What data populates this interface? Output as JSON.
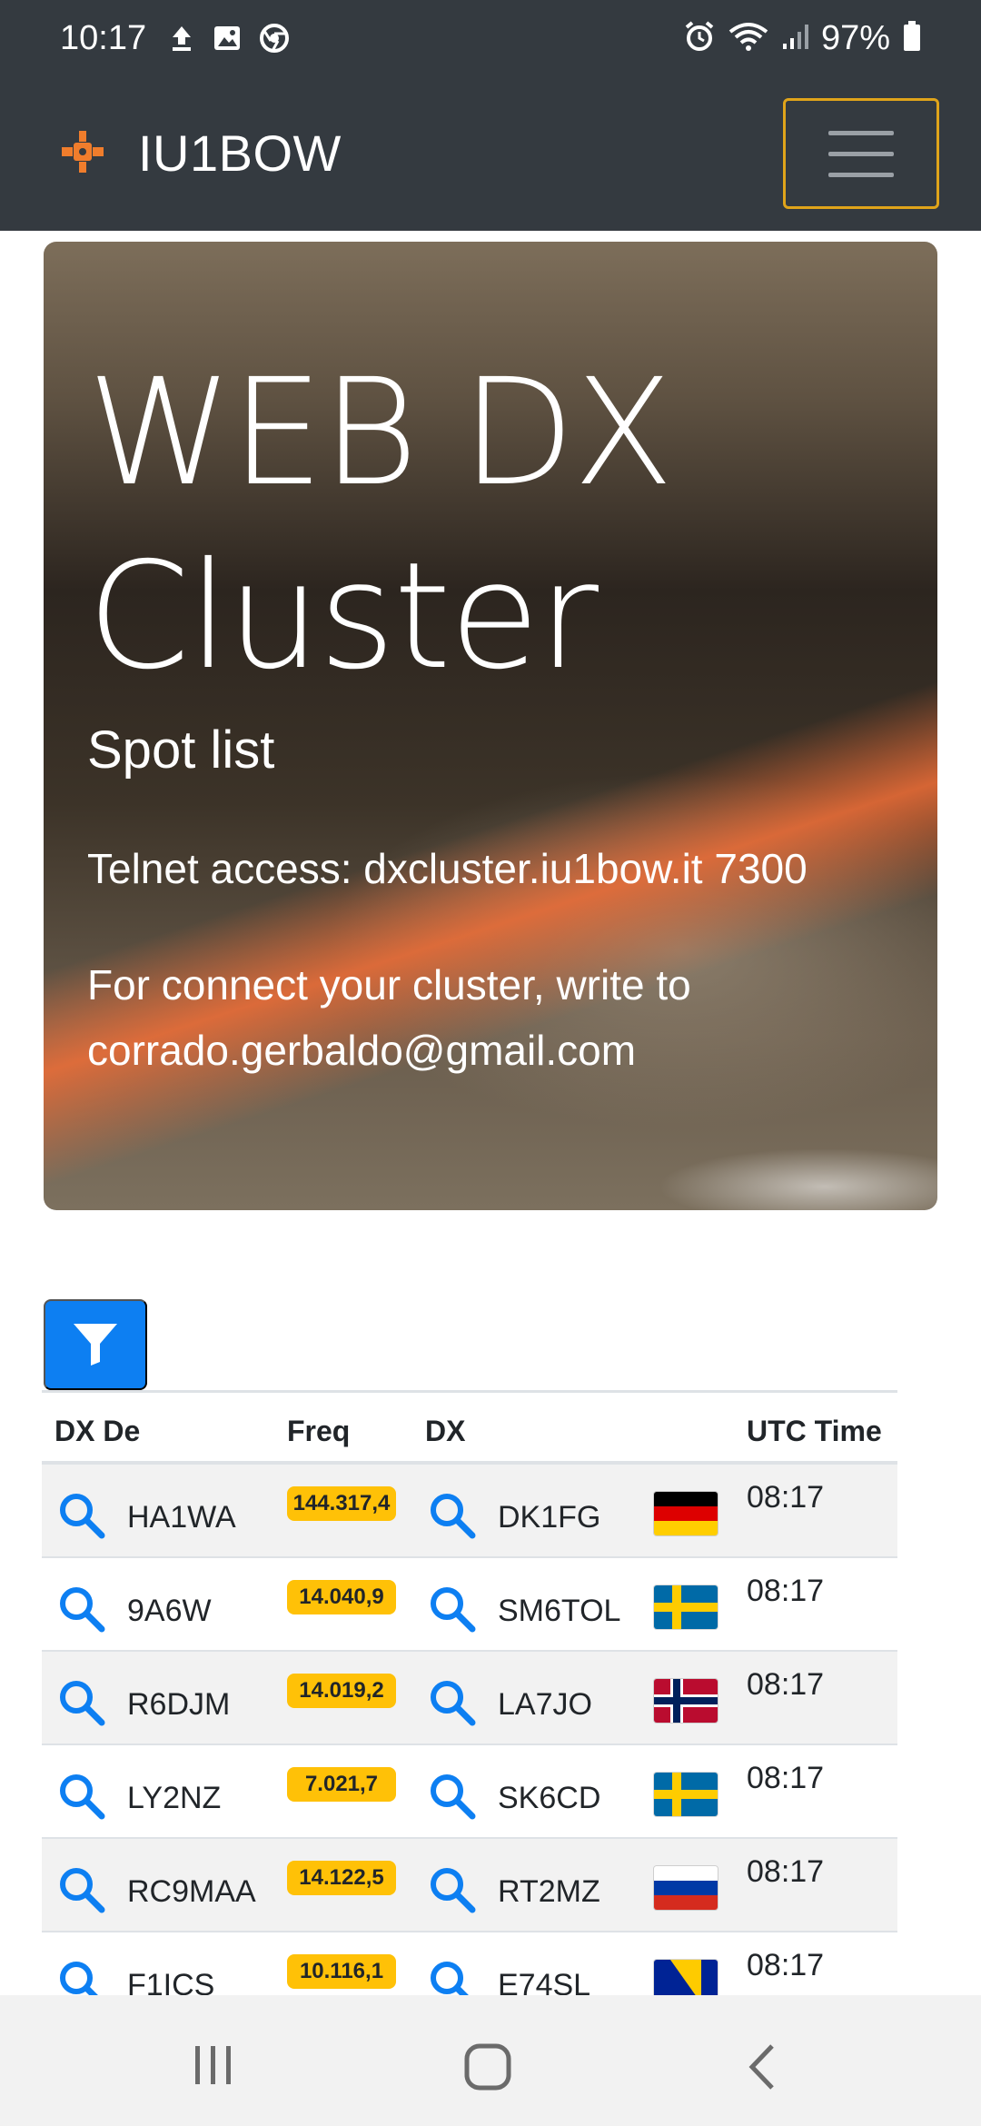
{
  "status_bar": {
    "time": "10:17",
    "battery": "97%",
    "left_icons": [
      "upload-icon",
      "image-icon",
      "chrome-icon"
    ],
    "right_icons": [
      "alarm-icon",
      "wifi-icon",
      "signal-icon",
      "battery-icon"
    ]
  },
  "navbar": {
    "brand_title": "IU1BOW",
    "logo_icon": "satellite-icon",
    "menu_icon": "hamburger-icon"
  },
  "hero": {
    "title": "WEB DX Cluster",
    "subtitle": "Spot list",
    "telnet": "Telnet access: dxcluster.iu1bow.it 7300",
    "connect": "For connect your cluster, write to corrado.gerbaldo@gmail.com"
  },
  "filter": {
    "icon": "filter-icon"
  },
  "table": {
    "headers": {
      "dx_de": "DX De",
      "freq": "Freq",
      "dx": "DX",
      "utc": "UTC Time"
    },
    "rows": [
      {
        "de": "HA1WA",
        "freq": "144.317,4",
        "dx": "DK1FG",
        "flag": "germany",
        "utc": "08:17"
      },
      {
        "de": "9A6W",
        "freq": "14.040,9",
        "dx": "SM6TOL",
        "flag": "sweden",
        "utc": "08:17"
      },
      {
        "de": "R6DJM",
        "freq": "14.019,2",
        "dx": "LA7JO",
        "flag": "norway",
        "utc": "08:17"
      },
      {
        "de": "LY2NZ",
        "freq": "7.021,7",
        "dx": "SK6CD",
        "flag": "sweden",
        "utc": "08:17"
      },
      {
        "de": "RC9MAA",
        "freq": "14.122,5",
        "dx": "RT2MZ",
        "flag": "russia",
        "utc": "08:17"
      },
      {
        "de": "F1ICS",
        "freq": "10.116,1",
        "dx": "E74SL",
        "flag": "bosnia",
        "utc": "08:17"
      }
    ]
  },
  "colors": {
    "navbar_bg": "#343a40",
    "accent_blue": "#0d7ff2",
    "badge_yellow": "#ffc107",
    "toggler_border": "#e0a41a"
  },
  "system_nav": [
    "recents-icon",
    "home-icon",
    "back-icon"
  ]
}
